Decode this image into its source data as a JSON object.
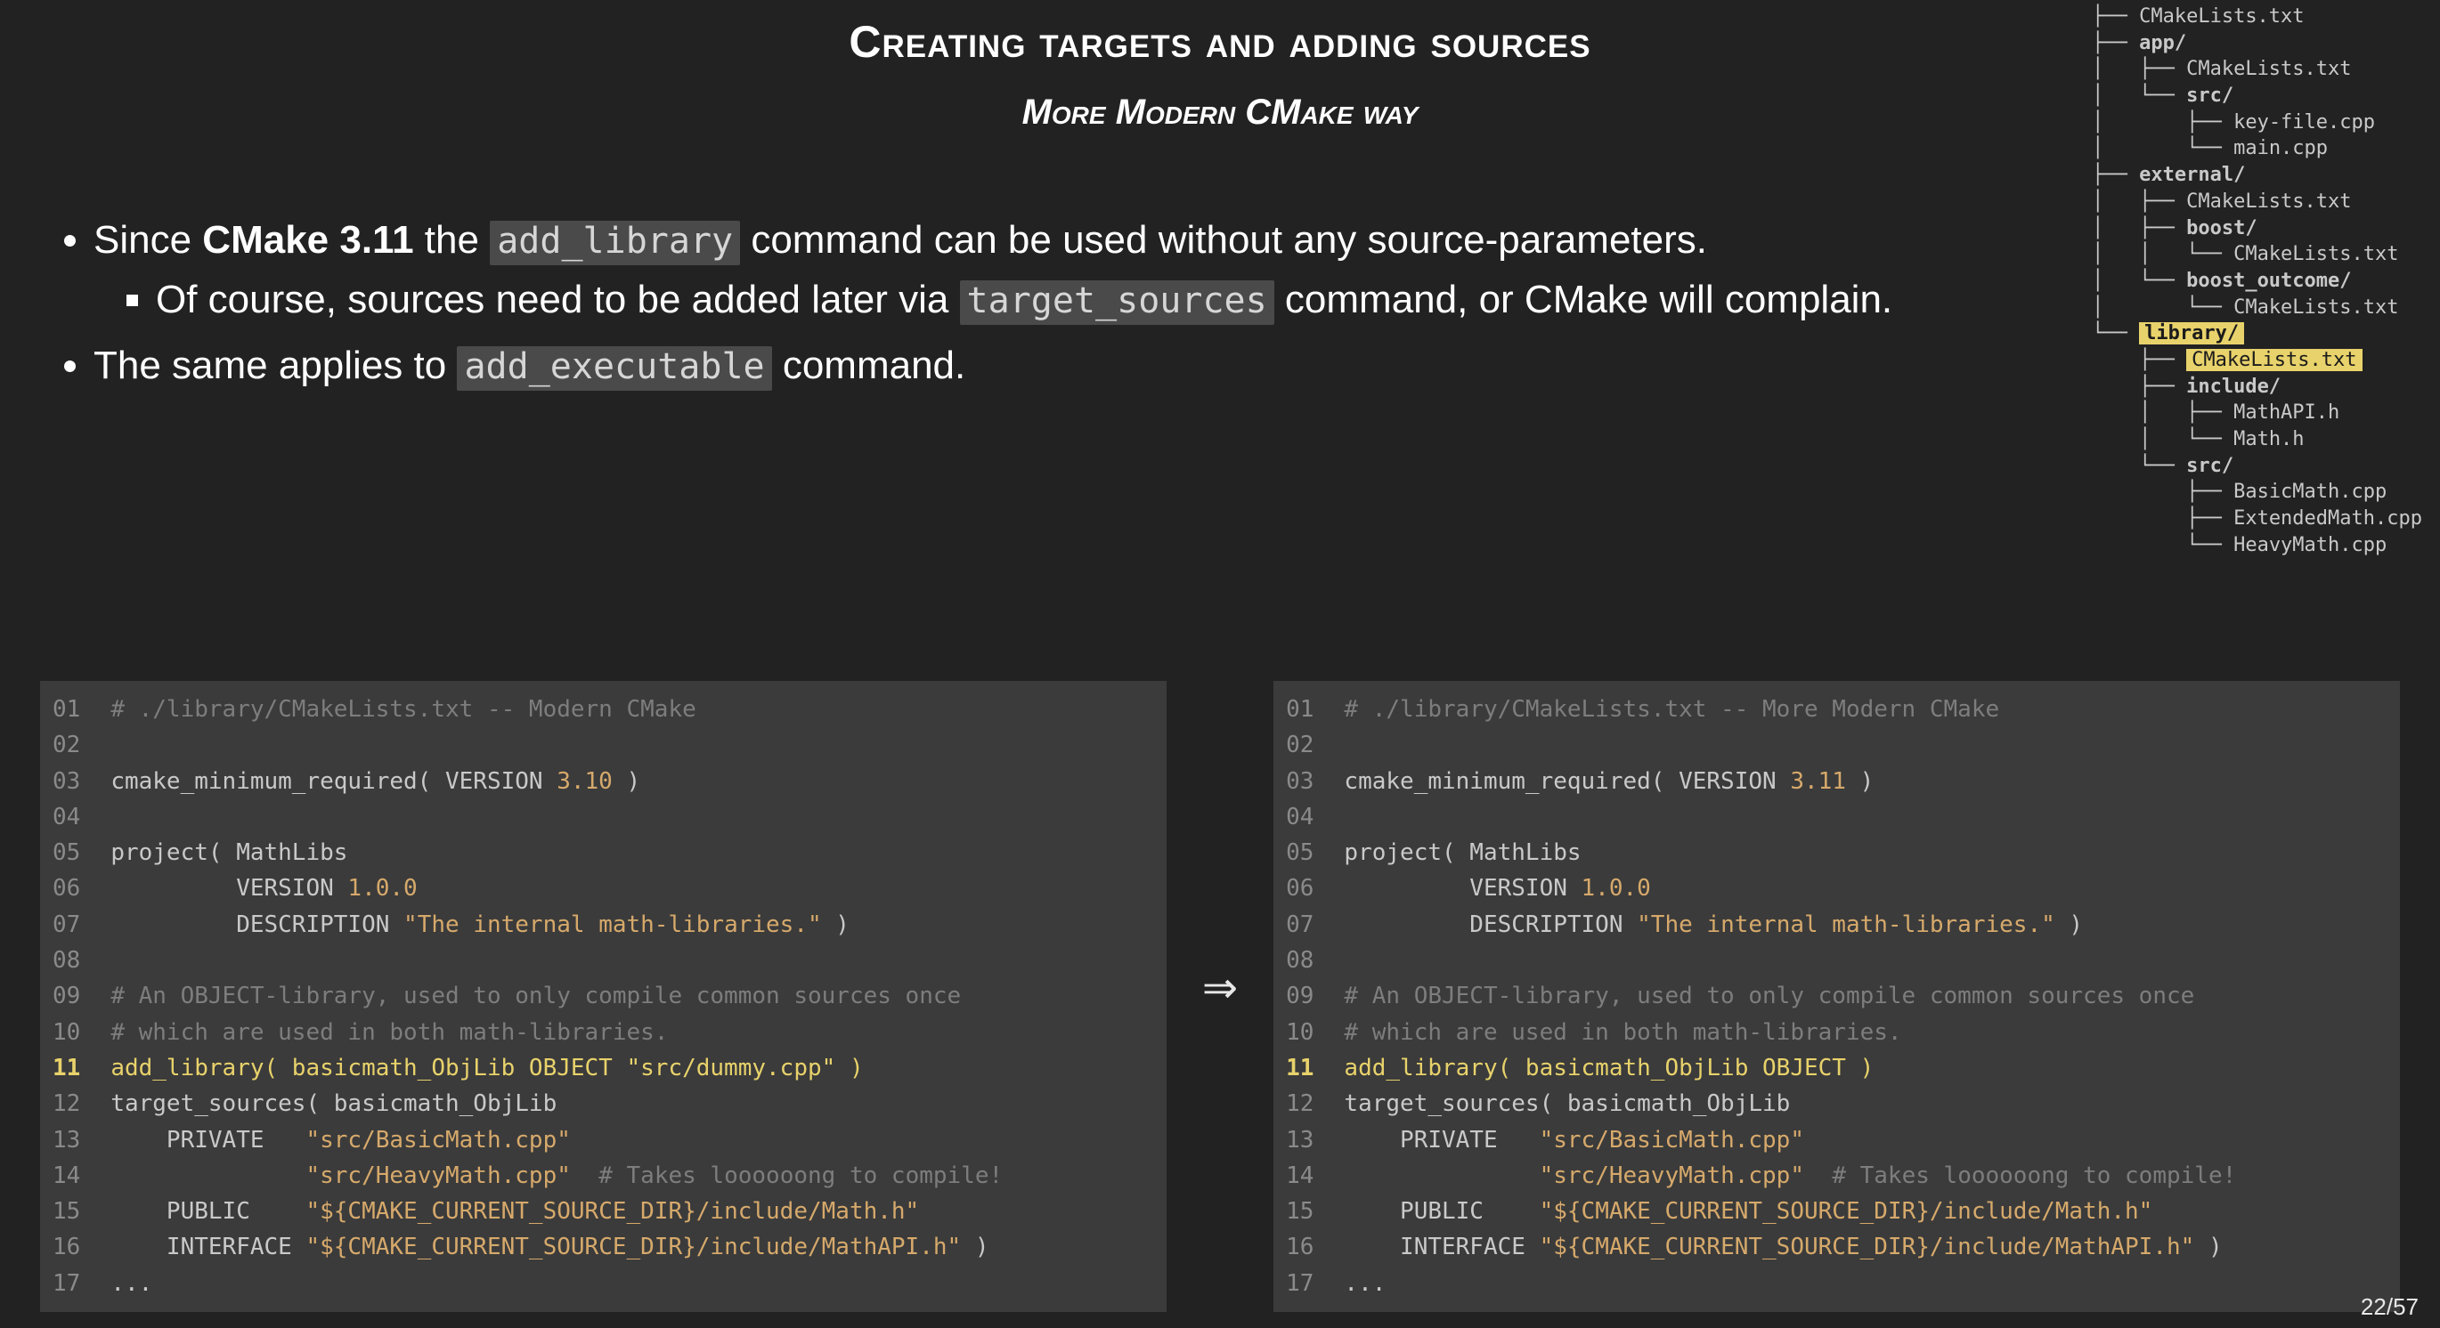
{
  "title": "Creating targets and adding sources",
  "subtitle_prefix": "More Modern ",
  "subtitle_italic": "CMake",
  "subtitle_suffix": " way",
  "bullets": {
    "b1_pre": "Since ",
    "b1_strong": "CMake 3.11",
    "b1_mid": " the ",
    "b1_code": "add_library",
    "b1_post": " command can be used without any source-parameters.",
    "b1a_pre": "Of course, sources need to be added later via ",
    "b1a_code": "target_sources",
    "b1a_post": " command, or CMake will complain.",
    "b2_pre": "The same applies to ",
    "b2_code": "add_executable",
    "b2_post": " command."
  },
  "arrow": "⇒",
  "code_left_html": "<span class=\"ln\">01</span>  <span class=\"cm\"># ./library/CMakeLists.txt -- Modern CMake</span>\n<span class=\"ln\">02</span>\n<span class=\"ln\">03</span>  <span class=\"fn\">cmake_minimum_required( VERSION </span><span class=\"nm\">3.10</span><span class=\"fn\"> )</span>\n<span class=\"ln\">04</span>\n<span class=\"ln\">05</span>  <span class=\"fn\">project( MathLibs</span>\n<span class=\"ln\">06</span>  <span class=\"fn\">         VERSION </span><span class=\"nm\">1.0.0</span>\n<span class=\"ln\">07</span>  <span class=\"fn\">         DESCRIPTION </span><span class=\"st\">\"The internal math-libraries.\"</span><span class=\"fn\"> )</span>\n<span class=\"ln\">08</span>\n<span class=\"ln\">09</span>  <span class=\"cm\"># An OBJECT-library, used to only compile common sources once</span>\n<span class=\"ln\">10</span>  <span class=\"cm\"># which are used in both math-libraries.</span>\n<span class=\"lnhl\">11</span>  <span class=\"hl\">add_library( basicmath_ObjLib OBJECT \"src/dummy.cpp\" )</span>\n<span class=\"ln\">12</span>  <span class=\"fn\">target_sources( basicmath_ObjLib</span>\n<span class=\"ln\">13</span>  <span class=\"fn\">    PRIVATE   </span><span class=\"st\">\"src/BasicMath.cpp\"</span>\n<span class=\"ln\">14</span>  <span class=\"fn\">              </span><span class=\"st\">\"src/HeavyMath.cpp\"</span><span class=\"fn\">  </span><span class=\"cm\"># Takes loooooong to compile!</span>\n<span class=\"ln\">15</span>  <span class=\"fn\">    PUBLIC    </span><span class=\"st\">\"${CMAKE_CURRENT_SOURCE_DIR}/include/Math.h\"</span>\n<span class=\"ln\">16</span>  <span class=\"fn\">    INTERFACE </span><span class=\"st\">\"${CMAKE_CURRENT_SOURCE_DIR}/include/MathAPI.h\"</span><span class=\"fn\"> )</span>\n<span class=\"ln\">17</span>  <span class=\"fn\">...</span>",
  "code_right_html": "<span class=\"ln\">01</span>  <span class=\"cm\"># ./library/CMakeLists.txt -- More Modern CMake</span>\n<span class=\"ln\">02</span>\n<span class=\"ln\">03</span>  <span class=\"fn\">cmake_minimum_required( VERSION </span><span class=\"nm\">3.11</span><span class=\"fn\"> )</span>\n<span class=\"ln\">04</span>\n<span class=\"ln\">05</span>  <span class=\"fn\">project( MathLibs</span>\n<span class=\"ln\">06</span>  <span class=\"fn\">         VERSION </span><span class=\"nm\">1.0.0</span>\n<span class=\"ln\">07</span>  <span class=\"fn\">         DESCRIPTION </span><span class=\"st\">\"The internal math-libraries.\"</span><span class=\"fn\"> )</span>\n<span class=\"ln\">08</span>\n<span class=\"ln\">09</span>  <span class=\"cm\"># An OBJECT-library, used to only compile common sources once</span>\n<span class=\"ln\">10</span>  <span class=\"cm\"># which are used in both math-libraries.</span>\n<span class=\"lnhl\">11</span>  <span class=\"hl\">add_library( basicmath_ObjLib OBJECT )</span>\n<span class=\"ln\">12</span>  <span class=\"fn\">target_sources( basicmath_ObjLib</span>\n<span class=\"ln\">13</span>  <span class=\"fn\">    PRIVATE   </span><span class=\"st\">\"src/BasicMath.cpp\"</span>\n<span class=\"ln\">14</span>  <span class=\"fn\">              </span><span class=\"st\">\"src/HeavyMath.cpp\"</span><span class=\"fn\">  </span><span class=\"cm\"># Takes loooooong to compile!</span>\n<span class=\"ln\">15</span>  <span class=\"fn\">    PUBLIC    </span><span class=\"st\">\"${CMAKE_CURRENT_SOURCE_DIR}/include/Math.h\"</span>\n<span class=\"ln\">16</span>  <span class=\"fn\">    INTERFACE </span><span class=\"st\">\"${CMAKE_CURRENT_SOURCE_DIR}/include/MathAPI.h\"</span><span class=\"fn\"> )</span>\n<span class=\"ln\">17</span>  <span class=\"fn\">...</span>",
  "tree_html": "├── <span class=\"label\">CMakeLists.txt</span>\n├── <span class=\"dir\">app/</span>\n│   ├── <span class=\"label\">CMakeLists.txt</span>\n│   └── <span class=\"dir\">src/</span>\n│       ├── <span class=\"label\">key-file.cpp</span>\n│       └── <span class=\"label\">main.cpp</span>\n├── <span class=\"dir\">external/</span>\n│   ├── <span class=\"label\">CMakeLists.txt</span>\n│   ├── <span class=\"dir\">boost/</span>\n│   │   └── <span class=\"label\">CMakeLists.txt</span>\n│   └── <span class=\"dir\">boost_outcome/</span>\n│       └── <span class=\"label\">CMakeLists.txt</span>\n└── <span class=\"seldir\">library/</span>\n    ├── <span class=\"sel\">CMakeLists.txt</span>\n    ├── <span class=\"dir\">include/</span>\n    │   ├── <span class=\"label\">MathAPI.h</span>\n    │   └── <span class=\"label\">Math.h</span>\n    └── <span class=\"dir\">src/</span>\n        ├── <span class=\"label\">BasicMath.cpp</span>\n        ├── <span class=\"label\">ExtendedMath.cpp</span>\n        └── <span class=\"label\">HeavyMath.cpp</span>",
  "pagenum": "22/57"
}
